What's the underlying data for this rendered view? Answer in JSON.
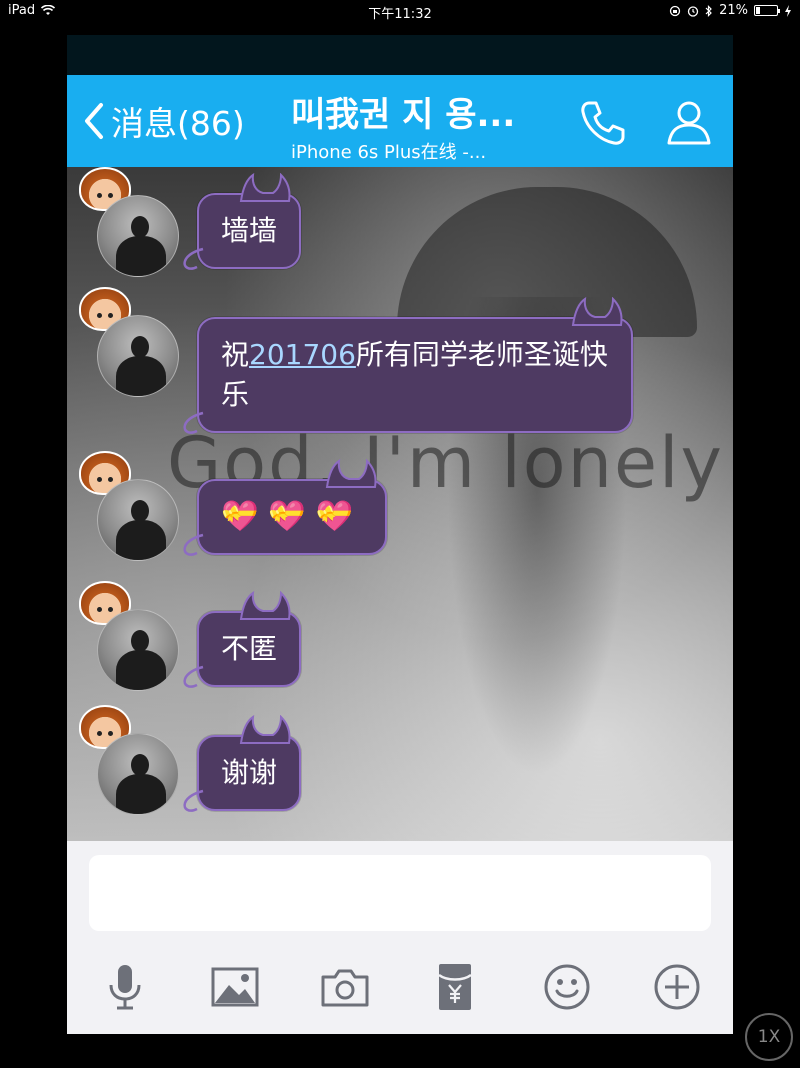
{
  "status_bar": {
    "device": "iPad",
    "time": "下午11:32",
    "battery_percent": "21%",
    "battery_level": 0.21
  },
  "header": {
    "back_label": "消息(86)",
    "contact_name": "叫我권 지 용...",
    "contact_status": "iPhone 6s Plus在线 -...",
    "icons": [
      "phone-icon",
      "profile-icon"
    ]
  },
  "background": {
    "wall_text": "God, I'm lonely"
  },
  "messages": [
    {
      "text": "墙墙"
    },
    {
      "prefix": "祝",
      "link": "201706",
      "suffix": "所有同学老师圣诞快乐"
    },
    {
      "emojis": [
        "💝",
        "💝",
        "💝"
      ]
    },
    {
      "text": "不匿"
    },
    {
      "text": "谢谢"
    }
  ],
  "input": {
    "placeholder": ""
  },
  "toolbar": {
    "icons": [
      "microphone-icon",
      "image-icon",
      "camera-icon",
      "red-packet-icon",
      "emoji-icon",
      "plus-icon"
    ]
  },
  "zoom_label": "1X",
  "colors": {
    "header": "#19aef0",
    "bubble": "#4e3a62",
    "bubble_border": "#8d6cc2",
    "input_bg": "#f2f2f5"
  }
}
